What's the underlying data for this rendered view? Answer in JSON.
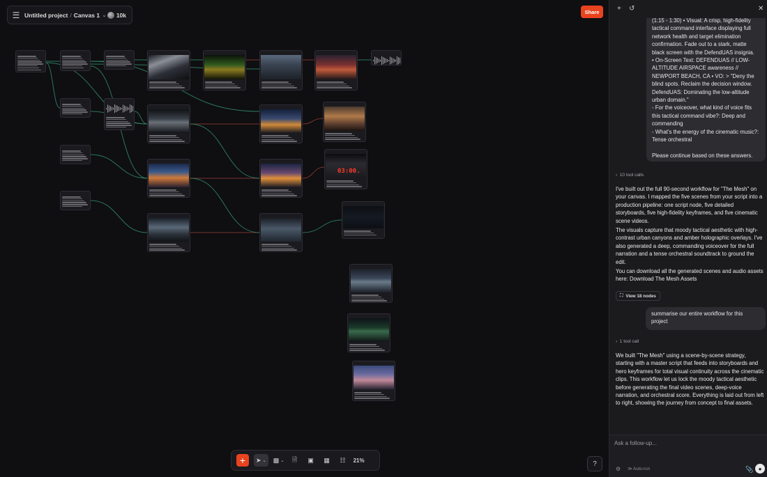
{
  "header": {
    "menu_icon": "hamburger-icon",
    "project_title": "Untitled project",
    "separator": "/",
    "canvas_name": "Canvas 1",
    "credits": "10k",
    "share_label": "Share"
  },
  "colors": {
    "accent": "#e8431f",
    "canvas_bg": "#0f0e11",
    "panel_bg": "#1b1b1e",
    "wire_green": "#2f8a6a",
    "wire_red": "#8a3b35"
  },
  "toolbar": {
    "add_icon": "plus-icon",
    "select_icon": "cursor-icon",
    "sticky_icon": "sticky-note-icon",
    "doc_icon": "document-icon",
    "image_icon": "image-icon",
    "layout_icon": "layout-icon",
    "map_icon": "map-icon",
    "zoom": "21%"
  },
  "help_label": "?",
  "panel": {
    "quote_text": "(1:15 - 1:30) •  Visual: A crisp, high-fidelity tactical command interface displaying full network health and target elimination confirmation. Fade out to a stark, matte black screen with the DefendUAS insignia.\n•   On-Screen Text: DEFENDUAS // LOW-ALTITUDE AIRSPACE awareness // NEWPORT BEACH, CA •     VO: > \"Deny the blind spots. Reclaim the decision window. DefendUAS: Dominating the low-altitude urban domain.\"\n- For the voiceover, what kind of voice fits this tactical command vibe?: Deep and commanding\n- What's the energy of the cinematic music?: Tense orchestral\n\nPlease continue based on these answers.",
    "tool_calls_1": "10 tool calls",
    "assistant_msg_1_p1": "I've built out the full 90-second workflow for \"The Mesh\" on your canvas. I mapped the five scenes from your script into a production pipeline: one script node, five detailed storyboards, five high-fidelity keyframes, and five cinematic scene videos.",
    "assistant_msg_1_p2": "The visuals capture that moody tactical aesthetic with high-contrast urban canyons and amber holographic overlays. I've also generated a deep, commanding voiceover for the full narration and a tense orchestral soundtrack to ground the edit.",
    "assistant_msg_1_p3": "You can download all the generated scenes and audio assets here: Download The Mesh Assets",
    "view_nodes": "View 18 nodes",
    "user_msg_2": "summarise our entire workflow for this project",
    "tool_calls_2": "1 tool call",
    "assistant_msg_2": "We built \"The Mesh\" using a scene-by-scene strategy, starting with a master script that feeds into storyboards and hero keyframes for total visual continuity across the cinematic clips. This workflow let us lock the moody tactical aesthetic before generating the final video scenes, deep-voice narration, and orchestral score. Everything is laid out from left to right, showing the journey from concept to final assets.",
    "input_placeholder": "Ask a follow-up...",
    "autorun": "Auto-run",
    "countdown_text": "03:00."
  }
}
